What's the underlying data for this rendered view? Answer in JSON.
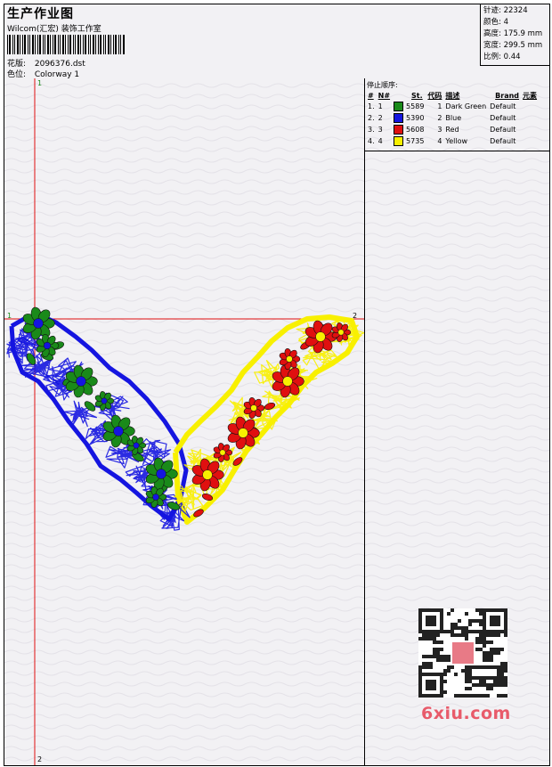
{
  "header": {
    "title": "生产作业图",
    "company": "Wilcom(汇宏) 装饰工作室",
    "design_label": "花版:",
    "design_value": "2096376.dst",
    "colorway_label": "色位:",
    "colorway_value": "Colorway 1"
  },
  "stats": [
    {
      "label": "针迹:",
      "value": "22324"
    },
    {
      "label": "颜色:",
      "value": "4"
    },
    {
      "label": "高度:",
      "value": "175.9 mm"
    },
    {
      "label": "宽度:",
      "value": "299.5 mm"
    },
    {
      "label": "比例:",
      "value": "0.44"
    }
  ],
  "stop_sequence": {
    "title": "停止顺序:",
    "columns": [
      "#",
      "N#",
      "St.",
      "代码",
      "描述",
      "Brand",
      "元素"
    ],
    "rows": [
      {
        "index": "1.",
        "n": "1",
        "stitches": "5589",
        "code": "1",
        "description": "Dark Green",
        "brand": "Default",
        "color": "#1a8a1a"
      },
      {
        "index": "2.",
        "n": "2",
        "stitches": "5390",
        "code": "2",
        "description": "Blue",
        "brand": "Default",
        "color": "#1515e0"
      },
      {
        "index": "3.",
        "n": "3",
        "stitches": "5608",
        "code": "3",
        "description": "Red",
        "brand": "Default",
        "color": "#e01010"
      },
      {
        "index": "4.",
        "n": "4",
        "stitches": "5735",
        "code": "4",
        "description": "Yellow",
        "brand": "Default",
        "color": "#f8f000"
      }
    ]
  },
  "axes": {
    "v_top": "1",
    "v_bottom": "2",
    "h_left": "1",
    "h_right": "2"
  },
  "watermark": {
    "text": "6xiu.com",
    "color": "#e85a6a"
  },
  "colors": {
    "guide_line": "#e01010",
    "axis_number": "#1a8a1a"
  }
}
